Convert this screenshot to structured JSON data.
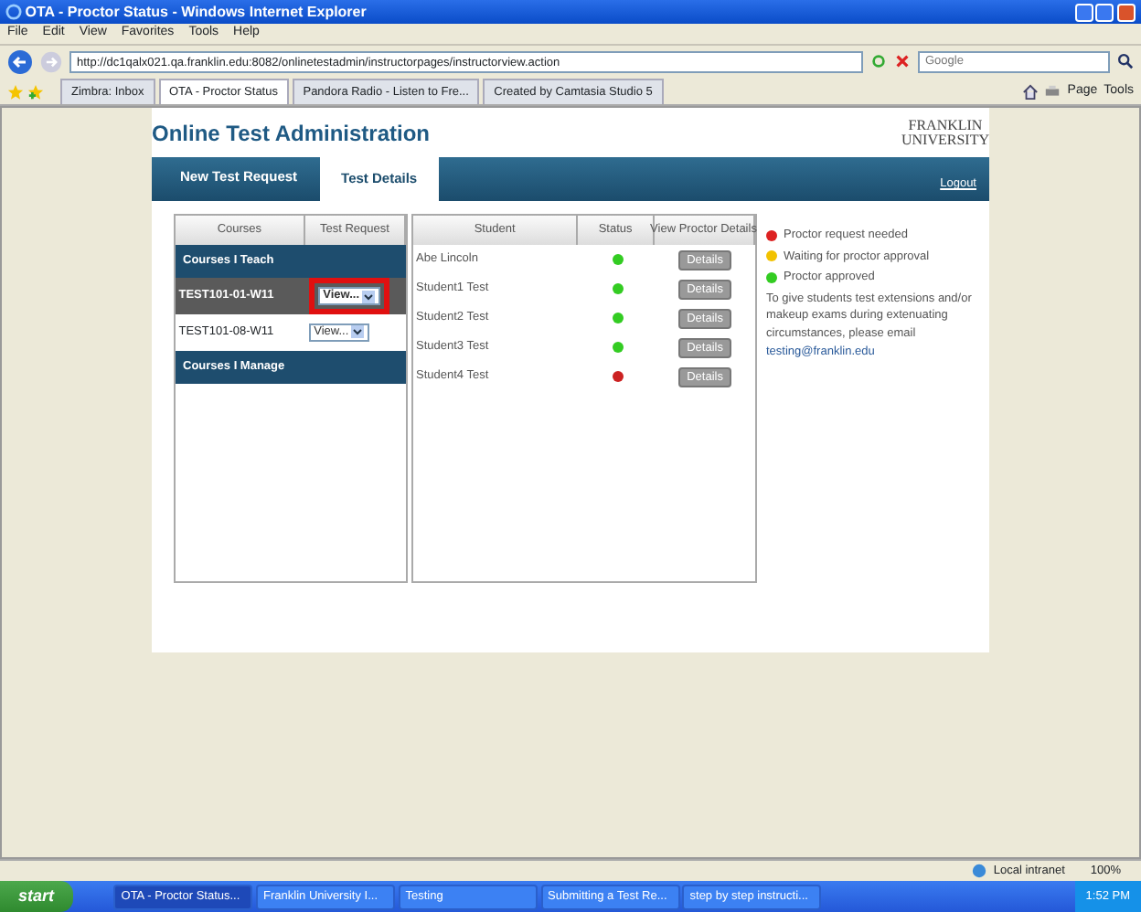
{
  "window": {
    "title": "OTA - Proctor Status - Windows Internet Explorer"
  },
  "menu": [
    "File",
    "Edit",
    "View",
    "Favorites",
    "Tools",
    "Help"
  ],
  "address": {
    "value": "http://dc1qalx021.qa.franklin.edu:8082/onlinetestadmin/instructorpages/instructorview.action"
  },
  "search": {
    "placeholder": "Google"
  },
  "browser_tabs": [
    {
      "label": "Zimbra: Inbox",
      "selected": false
    },
    {
      "label": "OTA - Proctor Status",
      "selected": true
    },
    {
      "label": "Pandora Radio - Listen to Fre...",
      "selected": false
    },
    {
      "label": "Created by Camtasia Studio 5",
      "selected": false
    }
  ],
  "command_bar": [
    "Page",
    "Tools"
  ],
  "page": {
    "title": "Online Test Administration",
    "logo": [
      "FRANKLIN",
      "UNIVERSITY"
    ],
    "nav_tabs": [
      {
        "label": "New Test Request",
        "selected": false
      },
      {
        "label": "Test Details",
        "selected": true
      }
    ],
    "logout": "Logout",
    "courses": {
      "columns": [
        "Courses",
        "Test Request"
      ],
      "sections": [
        {
          "title": "Courses I Teach",
          "rows": [
            {
              "course": "TEST101-01-W11",
              "action": "View...",
              "selected": true,
              "annotated": true
            },
            {
              "course": "TEST101-08-W11",
              "action": "View...",
              "selected": false,
              "annotated": false
            }
          ]
        },
        {
          "title": "Courses I Manage"
        }
      ]
    },
    "students": {
      "columns": [
        "Student",
        "Status",
        "View Proctor Details"
      ],
      "rows": [
        {
          "name": "Abe Lincoln",
          "color": "#33cc22",
          "button": "Details"
        },
        {
          "name": "Student1 Test",
          "color": "#33cc22",
          "button": "Details"
        },
        {
          "name": "Student2 Test",
          "color": "#33cc22",
          "button": "Details"
        },
        {
          "name": "Student3 Test",
          "color": "#33cc22",
          "button": "Details"
        },
        {
          "name": "Student4 Test",
          "color": "#cc2222",
          "button": "Details"
        }
      ]
    },
    "legend": [
      {
        "label": "Proctor request needed",
        "color": "#dd2222"
      },
      {
        "label": "Waiting for proctor approval",
        "color": "#f2c200"
      },
      {
        "label": "Proctor approved",
        "color": "#33cc22"
      }
    ],
    "note": {
      "text": "To give students test extensions and/or makeup exams during extenuating circumstances, please email",
      "email": "testing@franklin.edu"
    }
  },
  "status_bar": {
    "zone": "Local intranet",
    "zoom": "100%"
  },
  "taskbar": {
    "start": "start",
    "tasks": [
      {
        "label": "OTA - Proctor Status...",
        "selected": true
      },
      {
        "label": "Franklin University I...",
        "selected": false
      },
      {
        "label": "Testing",
        "selected": false
      },
      {
        "label": "Submitting a Test Re...",
        "selected": false
      },
      {
        "label": "step by step instructi...",
        "selected": false
      }
    ],
    "clock": "1:52 PM"
  }
}
